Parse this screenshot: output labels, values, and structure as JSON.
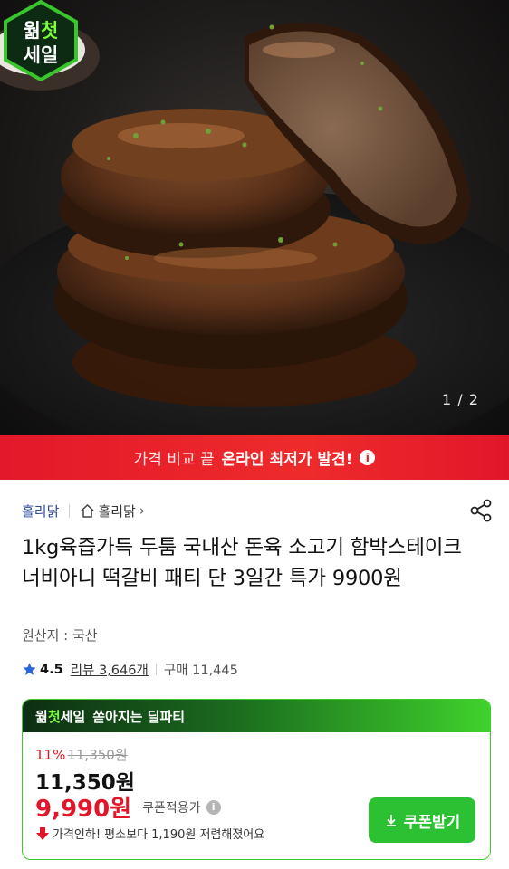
{
  "gallery": {
    "counter": "1 / 2",
    "badge": {
      "line1_a": "웖",
      "line1_b": "첫",
      "line2": "세일"
    }
  },
  "promo_banner": {
    "normal_text": "가격 비교 끝",
    "strong_text": "온라인 최저가 발견!",
    "info_icon": "i",
    "bg_color": "#e3182a"
  },
  "store": {
    "name": "홀리닭",
    "home_label": "홀리닭",
    "chevron": "›"
  },
  "product": {
    "title": "1kg육즙가득 두툼 국내산 돈육 소고기 함박스테이크 너비아니 떡갈비 패티 단 3일간 특가 9900원",
    "origin": "원산지 : 국산",
    "rating": "4.5",
    "reviews": "리뷰 3,646개",
    "purchases": "구매 11,445"
  },
  "deal": {
    "header_brand_a": "웖",
    "header_brand_b": "첫",
    "header_brand_c": "세일",
    "header_sub": "쏟아지는 딜파티",
    "discount_rate": "11%",
    "original_price": "11,350원",
    "sale_price": "11,350원",
    "coupon_price": "9,990원",
    "coupon_label": "쿠폰적용가",
    "drop_text": "가격인하! 평소보다 1,190원 저렴해졌어요",
    "coupon_button": "쿠폰받기",
    "accent_green": "#2bc133",
    "accent_red": "#e2162a"
  }
}
